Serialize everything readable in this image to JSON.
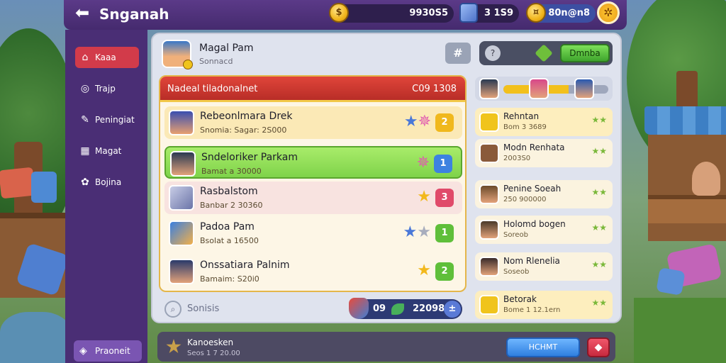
{
  "header": {
    "title": "Snganah",
    "currency1": "9930S5",
    "currency2": "3 1S9",
    "currency3": "80n@n8"
  },
  "sidebar": {
    "items": [
      {
        "label": "Kaaa",
        "icon": "home-icon"
      },
      {
        "label": "Trajp",
        "icon": "chat-icon"
      },
      {
        "label": "Peningiat",
        "icon": "tag-icon"
      },
      {
        "label": "Magat",
        "icon": "grid-icon"
      },
      {
        "label": "Bojina",
        "icon": "share-icon"
      }
    ],
    "footer_label": "Praoneit"
  },
  "profile": {
    "name": "Magal Pam",
    "subtitle": "Sonnacd"
  },
  "actions": {
    "hash_label": "#",
    "go_label": "Dmnba"
  },
  "ranking": {
    "header_title": "Nadeal tiladonalnet",
    "header_right": "C09 1308",
    "rows": [
      {
        "name": "Rebeonlmara Drek",
        "score": "Snomia: Sagar: 2S000",
        "badge": "2",
        "badge_color": "#f0b81c"
      },
      {
        "name": "Sndeloriker Parkam",
        "score": "Bamat a 30000",
        "badge": "1",
        "badge_color": "#3d82e0"
      },
      {
        "name": "Rasbalstom",
        "score": "Banbar 2 30360",
        "badge": "3",
        "badge_color": "#e04a6a"
      },
      {
        "name": "Padoa Pam",
        "score": "Bsolat a 16500",
        "badge": "1",
        "badge_color": "#5fbf3a"
      },
      {
        "name": "Onssatiara Palnim",
        "score": "Bamaim: S20i0",
        "badge": "2",
        "badge_color": "#5fbf3a"
      }
    ]
  },
  "search": {
    "label": "Sonisis"
  },
  "stats": {
    "value1": "09",
    "value2": "22098"
  },
  "right_panel": {
    "progress": 0.62,
    "cards": [
      {
        "name": "Rehntan",
        "score": "Bom 3 3689",
        "stars": "★★"
      },
      {
        "name": "Modn Renhata",
        "score": "2003S0",
        "stars": "★★"
      },
      {
        "name": "Penine Soeah",
        "score": "250 900000",
        "stars": "★★"
      },
      {
        "name": "Holomd bogen",
        "score": "Soreob",
        "stars": "★★"
      },
      {
        "name": "Nom Rlenelia",
        "score": "Soseob",
        "stars": "★★"
      },
      {
        "name": "Betorak",
        "score": "Bome 1 12.1ern",
        "stars": "★★"
      }
    ]
  },
  "footer": {
    "title": "Kanoesken",
    "subtitle": "Seos 1 7 20.00",
    "cta_label": "HCHMT"
  }
}
